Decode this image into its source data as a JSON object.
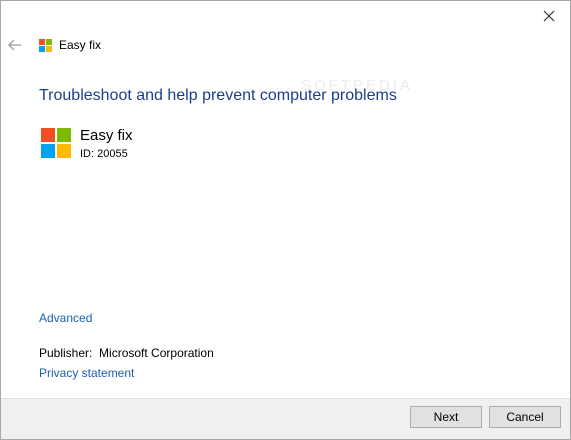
{
  "window": {
    "title": "Easy fix",
    "close_icon": "close-icon",
    "back_icon": "back-arrow-icon"
  },
  "main": {
    "heading": "Troubleshoot and help prevent computer problems",
    "watermark": "SOFTPEDIA",
    "app": {
      "name": "Easy fix",
      "id_text": "ID: 20055",
      "logo_icon": "windows-logo-icon"
    },
    "advanced_link": "Advanced",
    "publisher_label": "Publisher:",
    "publisher_value": "Microsoft Corporation",
    "privacy_link": "Privacy statement"
  },
  "footer": {
    "next_label": "Next",
    "cancel_label": "Cancel"
  },
  "colors": {
    "heading": "#1c3d8f",
    "link": "#1a5fb4",
    "logo_red": "#f25022",
    "logo_green": "#7fba00",
    "logo_blue": "#00a4ef",
    "logo_yellow": "#ffb900"
  }
}
